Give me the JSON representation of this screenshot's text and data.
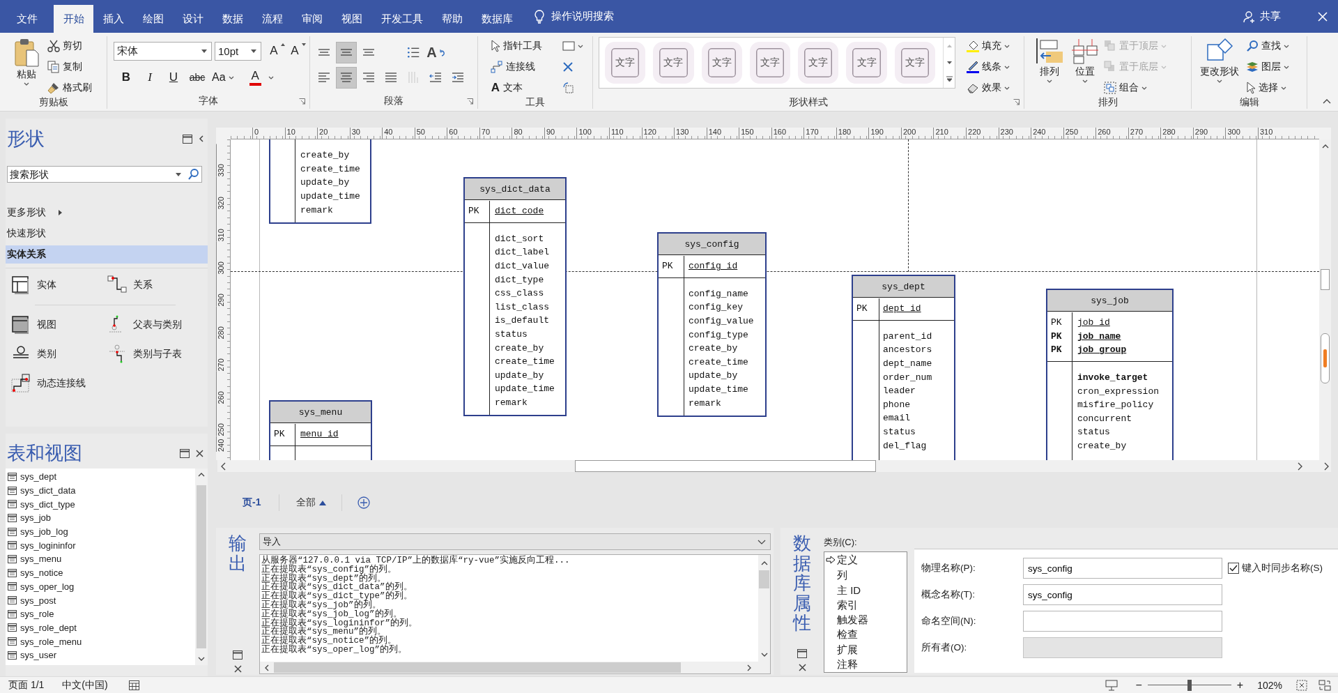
{
  "title_bar": {
    "tabs": [
      {
        "label": "文件",
        "selected": false
      },
      {
        "label": "开始",
        "selected": true
      },
      {
        "label": "插入",
        "selected": false
      },
      {
        "label": "绘图",
        "selected": false
      },
      {
        "label": "设计",
        "selected": false
      },
      {
        "label": "数据",
        "selected": false
      },
      {
        "label": "流程",
        "selected": false
      },
      {
        "label": "审阅",
        "selected": false
      },
      {
        "label": "视图",
        "selected": false
      },
      {
        "label": "开发工具",
        "selected": false
      },
      {
        "label": "帮助",
        "selected": false
      },
      {
        "label": "数据库",
        "selected": false
      }
    ],
    "tell_me": "操作说明搜索",
    "share": "共享"
  },
  "ribbon": {
    "clipboard": {
      "label": "剪贴板",
      "paste": "粘贴",
      "cut": "剪切",
      "copy": "复制",
      "format_painter": "格式刷"
    },
    "font": {
      "label": "字体",
      "font_name": "宋体",
      "font_size": "10pt",
      "grow": "A",
      "shrink": "A",
      "styles": [
        "B",
        "I",
        "U",
        "abc",
        "Aa"
      ],
      "color_button": "A"
    },
    "paragraph": {
      "label": "段落",
      "buttons": [
        {
          "kind": "align-top",
          "selected": false,
          "disabled": false
        },
        {
          "kind": "align-middle",
          "selected": true,
          "disabled": false
        },
        {
          "kind": "align-bottom",
          "selected": false,
          "disabled": false
        },
        {
          "kind": "bullets",
          "selected": false,
          "disabled": false
        },
        {
          "kind": "text-direction",
          "selected": false,
          "disabled": false,
          "glyph": "A"
        },
        {
          "kind": "align-left",
          "selected": false,
          "disabled": false
        },
        {
          "kind": "align-center",
          "selected": true,
          "disabled": false
        },
        {
          "kind": "align-right",
          "selected": false,
          "disabled": false
        },
        {
          "kind": "justify",
          "selected": false,
          "disabled": false
        },
        {
          "kind": "vertical-text",
          "selected": false,
          "disabled": true
        },
        {
          "kind": "outdent",
          "selected": false,
          "disabled": false
        },
        {
          "kind": "indent",
          "selected": false,
          "disabled": false
        }
      ]
    },
    "tools": {
      "label": "工具",
      "pointer": "指针工具",
      "connector": "连接线",
      "text": "文本",
      "text_glyph": "A"
    },
    "shape_styles": {
      "label": "形状样式",
      "tiles": [
        "文字",
        "文字",
        "文字",
        "文字",
        "文字",
        "文字",
        "文字"
      ],
      "fill": "填充",
      "line": "线条",
      "effects": "效果"
    },
    "arrange": {
      "label": "排列",
      "arrange": "排列",
      "position": "位置",
      "items": [
        {
          "kind": "front",
          "label": "置于顶层",
          "disabled": true
        },
        {
          "kind": "back",
          "label": "置于底层",
          "disabled": true
        },
        {
          "kind": "group",
          "label": "组合",
          "disabled": false
        }
      ]
    },
    "editing": {
      "label": "编辑",
      "change_shape": "更改形状",
      "find": "查找",
      "layers": "图层",
      "select": "选择"
    }
  },
  "shapes_panel": {
    "title": "形状",
    "search": {
      "placeholder": "搜索形状"
    },
    "menu": [
      {
        "label": "更多形状",
        "kind": "submenu",
        "selected": false
      },
      {
        "label": "快速形状",
        "kind": "item",
        "selected": false
      },
      {
        "label": "实体关系",
        "kind": "item",
        "selected": true
      }
    ],
    "stencils": [
      {
        "kind": "entity",
        "label": "实体"
      },
      {
        "kind": "relationship",
        "label": "关系"
      },
      {
        "kind": "view",
        "label": "视图"
      },
      {
        "kind": "parent-category",
        "label": "父表与类别"
      },
      {
        "kind": "category",
        "label": "类别"
      },
      {
        "kind": "category-child",
        "label": "类别与子表"
      },
      {
        "kind": "dynamic-connector",
        "label": "动态连接线"
      }
    ]
  },
  "tables_panel": {
    "title": "表和视图",
    "items": [
      "sys_dept",
      "sys_dict_data",
      "sys_dict_type",
      "sys_job",
      "sys_job_log",
      "sys_logininfor",
      "sys_menu",
      "sys_notice",
      "sys_oper_log",
      "sys_post",
      "sys_role",
      "sys_role_dept",
      "sys_role_menu",
      "sys_user"
    ]
  },
  "canvas": {
    "horizontal_ruler": [
      "0",
      "10",
      "20",
      "30",
      "40",
      "50",
      "60",
      "70",
      "80",
      "90",
      "100",
      "110",
      "120",
      "130",
      "140",
      "150",
      "160",
      "170",
      "180",
      "190",
      "200",
      "210",
      "220",
      "230",
      "240",
      "250",
      "260",
      "270",
      "280",
      "290",
      "300",
      "310"
    ],
    "vertical_ruler": [
      "330",
      "320",
      "310",
      "300",
      "290",
      "280",
      "270",
      "260",
      "250",
      "240"
    ],
    "entities": [
      {
        "columns": [
          {
            "name": "create_by",
            "bold": false
          },
          {
            "name": "create_time",
            "bold": false
          },
          {
            "name": "update_by",
            "bold": false
          },
          {
            "name": "update_time",
            "bold": false
          },
          {
            "name": "remark",
            "bold": false
          }
        ]
      },
      {
        "name": "sys_dict_data",
        "keys": [
          {
            "label": "PK",
            "name": "dict_code",
            "bold": false
          }
        ],
        "columns": [
          {
            "name": "dict_sort",
            "bold": false
          },
          {
            "name": "dict_label",
            "bold": false
          },
          {
            "name": "dict_value",
            "bold": false
          },
          {
            "name": "dict_type",
            "bold": false
          },
          {
            "name": "css_class",
            "bold": false
          },
          {
            "name": "list_class",
            "bold": false
          },
          {
            "name": "is_default",
            "bold": false
          },
          {
            "name": "status",
            "bold": false
          },
          {
            "name": "create_by",
            "bold": false
          },
          {
            "name": "create_time",
            "bold": false
          },
          {
            "name": "update_by",
            "bold": false
          },
          {
            "name": "update_time",
            "bold": false
          },
          {
            "name": "remark",
            "bold": false
          }
        ]
      },
      {
        "name": "sys_config",
        "keys": [
          {
            "label": "PK",
            "name": "config_id",
            "bold": false
          }
        ],
        "columns": [
          {
            "name": "config_name",
            "bold": false
          },
          {
            "name": "config_key",
            "bold": false
          },
          {
            "name": "config_value",
            "bold": false
          },
          {
            "name": "config_type",
            "bold": false
          },
          {
            "name": "create_by",
            "bold": false
          },
          {
            "name": "create_time",
            "bold": false
          },
          {
            "name": "update_by",
            "bold": false
          },
          {
            "name": "update_time",
            "bold": false
          },
          {
            "name": "remark",
            "bold": false
          }
        ]
      },
      {
        "name": "sys_dept",
        "keys": [
          {
            "label": "PK",
            "name": "dept_id",
            "bold": false
          }
        ],
        "columns": [
          {
            "name": "parent_id",
            "bold": false
          },
          {
            "name": "ancestors",
            "bold": false
          },
          {
            "name": "dept_name",
            "bold": false
          },
          {
            "name": "order_num",
            "bold": false
          },
          {
            "name": "leader",
            "bold": false
          },
          {
            "name": "phone",
            "bold": false
          },
          {
            "name": "email",
            "bold": false
          },
          {
            "name": "status",
            "bold": false
          },
          {
            "name": "del_flag",
            "bold": false
          }
        ]
      },
      {
        "name": "sys_job",
        "keys": [
          {
            "label": "PK",
            "name": "job_id",
            "bold": false
          },
          {
            "label": "PK",
            "name": "job_name",
            "bold": true
          },
          {
            "label": "PK",
            "name": "job_group",
            "bold": true
          }
        ],
        "columns": [
          {
            "name": "invoke_target",
            "bold": true
          },
          {
            "name": "cron_expression",
            "bold": false
          },
          {
            "name": "misfire_policy",
            "bold": false
          },
          {
            "name": "concurrent",
            "bold": false
          },
          {
            "name": "status",
            "bold": false
          },
          {
            "name": "create_by",
            "bold": false
          }
        ]
      },
      {
        "name": "sys_menu",
        "keys": [
          {
            "label": "PK",
            "name": "menu_id",
            "bold": false
          }
        ]
      }
    ]
  },
  "page_bar": {
    "tabs": [
      {
        "label": "页-1",
        "selected": true
      }
    ],
    "all_pages": "全部"
  },
  "output": {
    "title": "输出",
    "source": "导入",
    "lines": [
      "从服务器“127.0.0.1 via TCP/IP”上的数据库“ry-vue”实施反向工程...",
      "正在提取表“sys_config”的列。",
      "正在提取表“sys_dept”的列。",
      "正在提取表“sys_dict_data”的列。",
      "正在提取表“sys_dict_type”的列。",
      "正在提取表“sys_job”的列。",
      "正在提取表“sys_job_log”的列。",
      "正在提取表“sys_logininfor”的列。",
      "正在提取表“sys_menu”的列。",
      "正在提取表“sys_notice”的列。",
      "正在提取表“sys_oper_log”的列。"
    ]
  },
  "db_properties": {
    "title": "数据库属性",
    "categories_label": "类别(C):",
    "categories": [
      {
        "label": "定义",
        "selected": true
      },
      {
        "label": "列",
        "selected": false
      },
      {
        "label": "主 ID",
        "selected": false
      },
      {
        "label": "索引",
        "selected": false
      },
      {
        "label": "触发器",
        "selected": false
      },
      {
        "label": "检查",
        "selected": false
      },
      {
        "label": "扩展",
        "selected": false
      },
      {
        "label": "注释",
        "selected": false
      }
    ],
    "fields": [
      {
        "label": "物理名称(P):",
        "value": "sys_config",
        "disabled": false
      },
      {
        "label": "概念名称(T):",
        "value": "sys_config",
        "disabled": false
      },
      {
        "label": "命名空间(N):",
        "disabled": false
      },
      {
        "label": "所有者(O):",
        "disabled": true
      }
    ],
    "sync_names": {
      "label": "键入时同步名称(S)",
      "checked": true
    }
  },
  "status_bar": {
    "page": "页面 1/1",
    "language": "中文(中国)",
    "zoom_out": "−",
    "zoom_in": "+",
    "zoom": {
      "level": 0.5
    },
    "zoom_reading": "102%"
  }
}
